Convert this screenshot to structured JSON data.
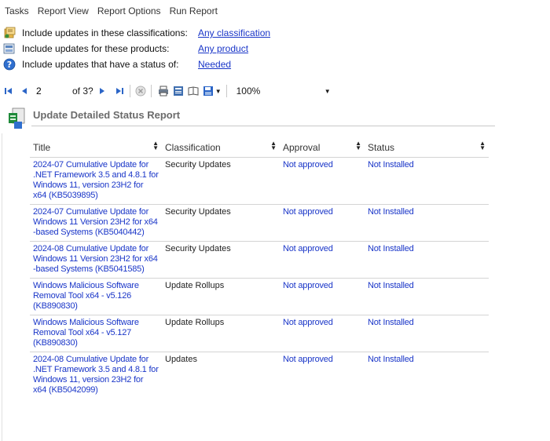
{
  "menu": [
    "Tasks",
    "Report View",
    "Report Options",
    "Run Report"
  ],
  "filters": [
    {
      "label": "Include updates in these classifications:",
      "value": "Any classification",
      "icon": "classification-icon"
    },
    {
      "label": "Include updates for these products:",
      "value": "Any product",
      "icon": "product-icon"
    },
    {
      "label": "Include updates that have a status of:",
      "value": "Needed",
      "icon": "help-icon"
    }
  ],
  "toolbar": {
    "page": "2",
    "of_label": "of 3?",
    "zoom": "100%"
  },
  "report": {
    "title": "Update Detailed Status Report",
    "columns": [
      "Title",
      "Classification",
      "Approval",
      "Status"
    ],
    "rows": [
      {
        "title": "2024-07 Cumulative Update for .NET Framework 3.5 and 4.8.1 for Windows 11, version 23H2 for x64 (KB5039895)",
        "classification": "Security Updates",
        "approval": "Not approved",
        "status": "Not Installed"
      },
      {
        "title": "2024-07 Cumulative Update for Windows 11 Version 23H2 for x64 -based Systems (KB5040442)",
        "classification": "Security Updates",
        "approval": "Not approved",
        "status": "Not Installed"
      },
      {
        "title": "2024-08 Cumulative Update for Windows 11 Version 23H2 for x64 -based Systems (KB5041585)",
        "classification": "Security Updates",
        "approval": "Not approved",
        "status": "Not Installed"
      },
      {
        "title": "Windows Malicious Software Removal Tool x64 - v5.126 (KB890830)",
        "classification": "Update Rollups",
        "approval": "Not approved",
        "status": "Not Installed"
      },
      {
        "title": "Windows Malicious Software Removal Tool x64 - v5.127 (KB890830)",
        "classification": "Update Rollups",
        "approval": "Not approved",
        "status": "Not Installed"
      },
      {
        "title": "2024-08 Cumulative Update for .NET Framework 3.5 and 4.8.1 for Windows 11, version 23H2 for x64 (KB5042099)",
        "classification": "Updates",
        "approval": "Not approved",
        "status": "Not Installed"
      }
    ]
  }
}
